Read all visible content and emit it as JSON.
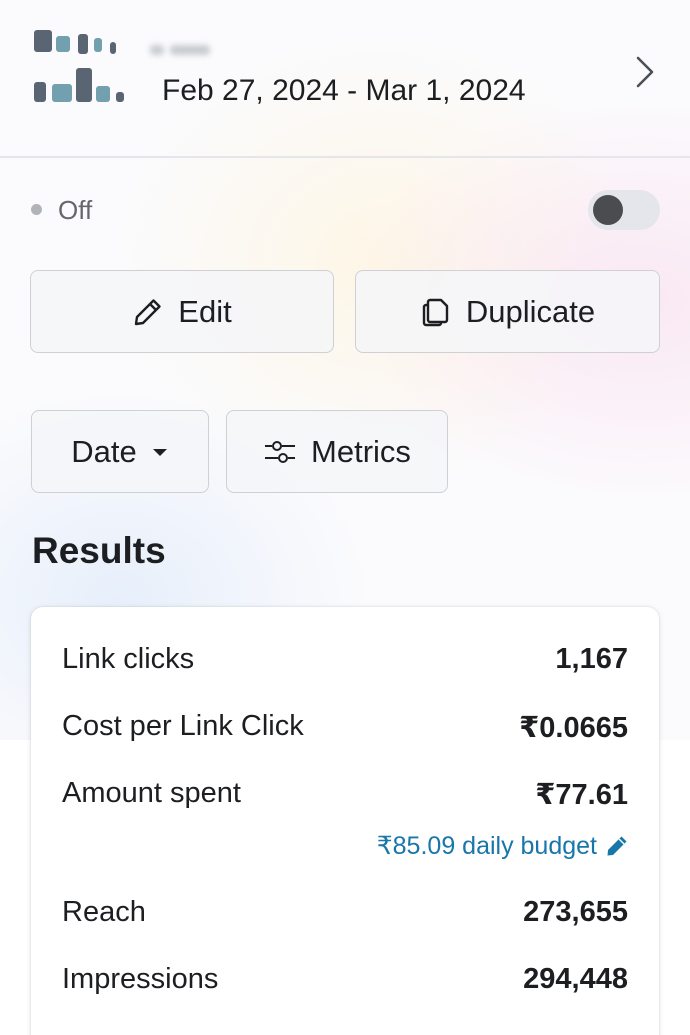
{
  "header": {
    "date_range": "Feb 27, 2024 - Mar 1, 2024"
  },
  "status": {
    "label": "Off",
    "toggle_on": false
  },
  "actions": {
    "edit_label": "Edit",
    "duplicate_label": "Duplicate"
  },
  "filters": {
    "date_label": "Date",
    "metrics_label": "Metrics"
  },
  "results": {
    "title": "Results",
    "rows": [
      {
        "label": "Link clicks",
        "value": "1,167"
      },
      {
        "label": "Cost per Link Click",
        "value": "₹0.0665"
      },
      {
        "label": "Amount spent",
        "value": "₹77.61"
      },
      {
        "label": "Reach",
        "value": "273,655"
      },
      {
        "label": "Impressions",
        "value": "294,448"
      }
    ],
    "budget_link": "₹85.09 daily budget"
  },
  "colors": {
    "accent_link": "#1877a8",
    "text_primary": "#1c1e21",
    "text_secondary": "#65676b"
  }
}
